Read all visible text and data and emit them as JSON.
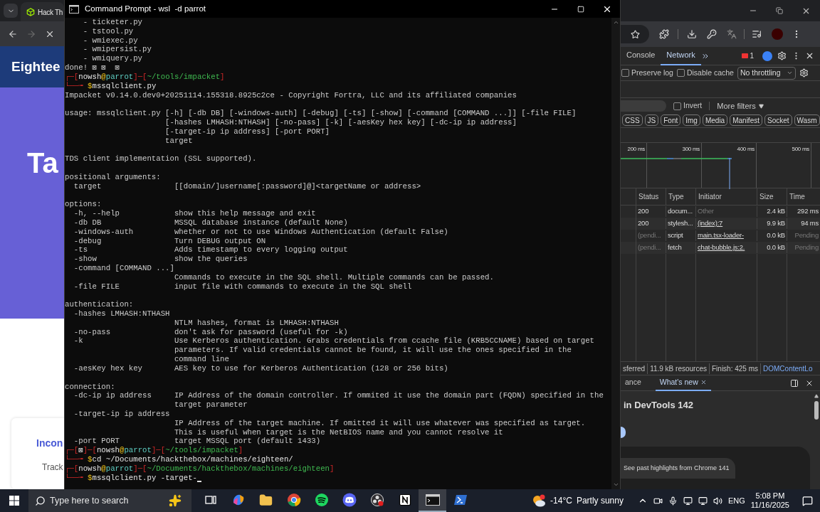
{
  "browser": {
    "tab_title": "Hack Th",
    "page": {
      "header_title": "Eightee",
      "hero_title": "Ta",
      "card_title": "Incon",
      "card_text": "Track"
    }
  },
  "terminal": {
    "title": "Command Prompt - wsl  -d parrot",
    "lines": [
      {
        "kind": "text",
        "text": "    - ticketer.py"
      },
      {
        "kind": "text",
        "text": "    - tstool.py"
      },
      {
        "kind": "text",
        "text": "    - wmiexec.py"
      },
      {
        "kind": "text",
        "text": "    - wmipersist.py"
      },
      {
        "kind": "text",
        "text": "    - wmiquery.py"
      },
      {
        "kind": "text",
        "text": "done! ⊠ ⊠  ⊠"
      },
      {
        "kind": "spans",
        "spans": [
          {
            "text": "┌─[",
            "kind": "frame"
          },
          {
            "text": "nowsh",
            "kind": "user"
          },
          {
            "text": "@",
            "kind": "at"
          },
          {
            "text": "parrot",
            "kind": "host"
          },
          {
            "text": "]─[",
            "kind": "frame"
          },
          {
            "text": "~/tools/impacket",
            "kind": "path"
          },
          {
            "text": "]",
            "kind": "frame"
          }
        ]
      },
      {
        "kind": "spans",
        "spans": [
          {
            "text": "└──╼ ",
            "kind": "frame"
          },
          {
            "text": "$",
            "kind": "sign"
          },
          {
            "text": "mssqlclient.py",
            "kind": "command"
          }
        ]
      },
      {
        "kind": "text",
        "text": "Impacket v0.14.0.dev0+20251114.155318.8925c2ce - Copyright Fortra, LLC and its affiliated companies"
      },
      {
        "kind": "blank"
      },
      {
        "kind": "text",
        "text": "usage: mssqlclient.py [-h] [-db DB] [-windows-auth] [-debug] [-ts] [-show] [-command [COMMAND ...]] [-file FILE]"
      },
      {
        "kind": "text",
        "text": "                      [-hashes LMHASH:NTHASH] [-no-pass] [-k] [-aesKey hex key] [-dc-ip ip address]"
      },
      {
        "kind": "text",
        "text": "                      [-target-ip ip address] [-port PORT]"
      },
      {
        "kind": "text",
        "text": "                      target"
      },
      {
        "kind": "blank"
      },
      {
        "kind": "text",
        "text": "TDS client implementation (SSL supported)."
      },
      {
        "kind": "blank"
      },
      {
        "kind": "text",
        "text": "positional arguments:"
      },
      {
        "kind": "text",
        "text": "  target                [[domain/]username[:password]@]<targetName or address>"
      },
      {
        "kind": "blank"
      },
      {
        "kind": "text",
        "text": "options:"
      },
      {
        "kind": "text",
        "text": "  -h, --help            show this help message and exit"
      },
      {
        "kind": "text",
        "text": "  -db DB                MSSQL database instance (default None)"
      },
      {
        "kind": "text",
        "text": "  -windows-auth         whether or not to use Windows Authentication (default False)"
      },
      {
        "kind": "text",
        "text": "  -debug                Turn DEBUG output ON"
      },
      {
        "kind": "text",
        "text": "  -ts                   Adds timestamp to every logging output"
      },
      {
        "kind": "text",
        "text": "  -show                 show the queries"
      },
      {
        "kind": "text",
        "text": "  -command [COMMAND ...]"
      },
      {
        "kind": "text",
        "text": "                        Commands to execute in the SQL shell. Multiple commands can be passed."
      },
      {
        "kind": "text",
        "text": "  -file FILE            input file with commands to execute in the SQL shell"
      },
      {
        "kind": "blank"
      },
      {
        "kind": "text",
        "text": "authentication:"
      },
      {
        "kind": "text",
        "text": "  -hashes LMHASH:NTHASH"
      },
      {
        "kind": "text",
        "text": "                        NTLM hashes, format is LMHASH:NTHASH"
      },
      {
        "kind": "text",
        "text": "  -no-pass              don't ask for password (useful for -k)"
      },
      {
        "kind": "text",
        "text": "  -k                    Use Kerberos authentication. Grabs credentials from ccache file (KRB5CCNAME) based on target"
      },
      {
        "kind": "text",
        "text": "                        parameters. If valid credentials cannot be found, it will use the ones specified in the"
      },
      {
        "kind": "text",
        "text": "                        command line"
      },
      {
        "kind": "text",
        "text": "  -aesKey hex key       AES key to use for Kerberos Authentication (128 or 256 bits)"
      },
      {
        "kind": "blank"
      },
      {
        "kind": "text",
        "text": "connection:"
      },
      {
        "kind": "text",
        "text": "  -dc-ip ip address     IP Address of the domain controller. If ommited it use the domain part (FQDN) specified in the"
      },
      {
        "kind": "text",
        "text": "                        target parameter"
      },
      {
        "kind": "text",
        "text": "  -target-ip ip address"
      },
      {
        "kind": "text",
        "text": "                        IP Address of the target machine. If omitted it will use whatever was specified as target."
      },
      {
        "kind": "text",
        "text": "                        This is useful when target is the NetBIOS name and you cannot resolve it"
      },
      {
        "kind": "text",
        "text": "  -port PORT            target MSSQL port (default 1433)"
      },
      {
        "kind": "spans",
        "spans": [
          {
            "text": "┌─[",
            "kind": "frame"
          },
          {
            "text": "⊠",
            "kind": "user"
          },
          {
            "text": "]─[",
            "kind": "frame"
          },
          {
            "text": "nowsh",
            "kind": "user"
          },
          {
            "text": "@",
            "kind": "at"
          },
          {
            "text": "parrot",
            "kind": "host"
          },
          {
            "text": "]─[",
            "kind": "frame"
          },
          {
            "text": "~/tools/impacket",
            "kind": "path"
          },
          {
            "text": "]",
            "kind": "frame"
          }
        ]
      },
      {
        "kind": "spans",
        "spans": [
          {
            "text": "└──╼ ",
            "kind": "frame"
          },
          {
            "text": "$",
            "kind": "sign"
          },
          {
            "text": "cd ~/Documents/hackthebox/machines/eighteen/",
            "kind": "command"
          }
        ]
      },
      {
        "kind": "spans",
        "spans": [
          {
            "text": "┌─[",
            "kind": "frame"
          },
          {
            "text": "nowsh",
            "kind": "user"
          },
          {
            "text": "@",
            "kind": "at"
          },
          {
            "text": "parrot",
            "kind": "host"
          },
          {
            "text": "]─[",
            "kind": "frame"
          },
          {
            "text": "~/Documents/hackthebox/machines/eighteen",
            "kind": "path"
          },
          {
            "text": "]",
            "kind": "frame"
          }
        ]
      },
      {
        "kind": "spans",
        "cursor": true,
        "spans": [
          {
            "text": "└──╼ ",
            "kind": "frame"
          },
          {
            "text": "$",
            "kind": "sign"
          },
          {
            "text": "mssqlclient.py -target-",
            "kind": "command"
          }
        ]
      }
    ]
  },
  "devtools": {
    "tabs": [
      {
        "label": "Console",
        "selected": false
      },
      {
        "label": "Network",
        "selected": true
      }
    ],
    "issues_count": "1",
    "preserve_log": {
      "label": "Preserve log",
      "checked": false
    },
    "disable_cache": {
      "label": "Disable cache",
      "checked": false
    },
    "throttling": "No throttling",
    "invert": {
      "label": "Invert",
      "checked": false
    },
    "more_filters": "More filters",
    "type_filters": [
      {
        "label": "CSS",
        "selected": false
      },
      {
        "label": "JS",
        "selected": false
      },
      {
        "label": "Font",
        "selected": false
      },
      {
        "label": "Img",
        "selected": false
      },
      {
        "label": "Media",
        "selected": false
      },
      {
        "label": "Manifest",
        "selected": false
      },
      {
        "label": "Socket",
        "selected": false
      },
      {
        "label": "Wasm",
        "selected": false
      }
    ],
    "timeline_ticks": [
      "200 ms",
      "300 ms",
      "400 ms",
      "500 ms"
    ],
    "table": {
      "columns": [
        "Status",
        "Type",
        "Initiator",
        "Size",
        "Time"
      ],
      "rows": [
        {
          "status": "200",
          "type": "docum...",
          "initiator": "Other",
          "initiator_link": false,
          "size": "2.4 kB",
          "time": "292 ms",
          "pending": false
        },
        {
          "status": "200",
          "type": "stylesh...",
          "initiator": "(index):7",
          "initiator_link": true,
          "size": "9.9 kB",
          "time": "94 ms",
          "pending": false
        },
        {
          "status": "(pendi...",
          "type": "script",
          "initiator": "main.tsx-loader-",
          "initiator_link": true,
          "size": "0.0 kB",
          "time": "Pending",
          "pending": true
        },
        {
          "status": "(pendi...",
          "type": "fetch",
          "initiator": "chat-bubble.js:2.",
          "initiator_link": true,
          "size": "0.0 kB",
          "time": "Pending",
          "pending": true
        }
      ]
    },
    "summary": [
      {
        "text": "sferred",
        "kind": "metric"
      },
      {
        "text": "11.9 kB resources",
        "kind": "metric"
      },
      {
        "text": "Finish: 425 ms",
        "kind": "metric"
      },
      {
        "text": "DOMContentLo",
        "kind": "event"
      }
    ],
    "drawer_tabs": [
      {
        "label": "ance",
        "selected": false,
        "closable": false
      },
      {
        "label": "What's new",
        "selected": true,
        "closable": true
      }
    ],
    "drawer_heading": "in DevTools 142",
    "drawer_link": "See past highlights from Chrome 141"
  },
  "taskbar": {
    "search_placeholder": "Type here to search",
    "apps": [
      {
        "kind": "taskview",
        "active": false
      },
      {
        "kind": "copilot",
        "active": false
      },
      {
        "kind": "explorer",
        "active": false
      },
      {
        "kind": "chrome",
        "active": false
      },
      {
        "kind": "spotify",
        "active": false
      },
      {
        "kind": "discord",
        "active": false
      },
      {
        "kind": "obs",
        "active": false
      },
      {
        "kind": "notion",
        "active": false
      },
      {
        "kind": "terminal",
        "active": true
      },
      {
        "kind": "powershell",
        "active": false
      }
    ],
    "weather_temp": "-14°C",
    "weather_condition": "Partly sunny",
    "language": "ENG",
    "time": "5:08 PM",
    "date": "11/16/2025"
  }
}
